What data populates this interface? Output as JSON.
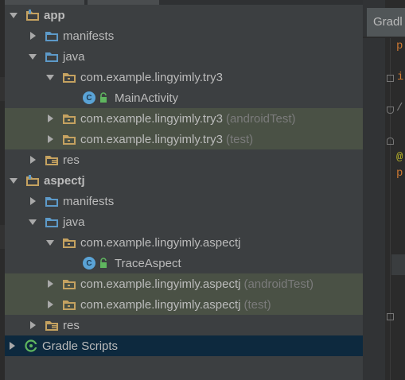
{
  "tree": {
    "rows": [
      {
        "label": "app",
        "suffix": ""
      },
      {
        "label": "manifests",
        "suffix": ""
      },
      {
        "label": "java",
        "suffix": ""
      },
      {
        "label": "com.example.lingyimly.try3",
        "suffix": ""
      },
      {
        "label": "MainActivity",
        "suffix": ""
      },
      {
        "label": "com.example.lingyimly.try3",
        "suffix": "(androidTest)"
      },
      {
        "label": "com.example.lingyimly.try3",
        "suffix": "(test)"
      },
      {
        "label": "res",
        "suffix": ""
      },
      {
        "label": "aspectj",
        "suffix": ""
      },
      {
        "label": "manifests",
        "suffix": ""
      },
      {
        "label": "java",
        "suffix": ""
      },
      {
        "label": "com.example.lingyimly.aspectj",
        "suffix": ""
      },
      {
        "label": "TraceAspect",
        "suffix": ""
      },
      {
        "label": "com.example.lingyimly.aspectj",
        "suffix": "(androidTest)"
      },
      {
        "label": "com.example.lingyimly.aspectj",
        "suffix": "(test)"
      },
      {
        "label": "res",
        "suffix": ""
      },
      {
        "label": "Gradle Scripts",
        "suffix": ""
      }
    ],
    "class_badge": "C"
  },
  "editor": {
    "tab_label": "Gradl",
    "gutter_chars": [
      "p",
      "i",
      "/",
      "@",
      "p"
    ]
  },
  "colors": {
    "panel_bg": "#3c3f41",
    "highlight_row": "#4a5145",
    "selected_row": "#0d293e",
    "folder_blue": "#5d9ac9",
    "package_tan": "#c5a260",
    "class_blue": "#5aa3d6",
    "gradle_green": "#5fb65f"
  }
}
